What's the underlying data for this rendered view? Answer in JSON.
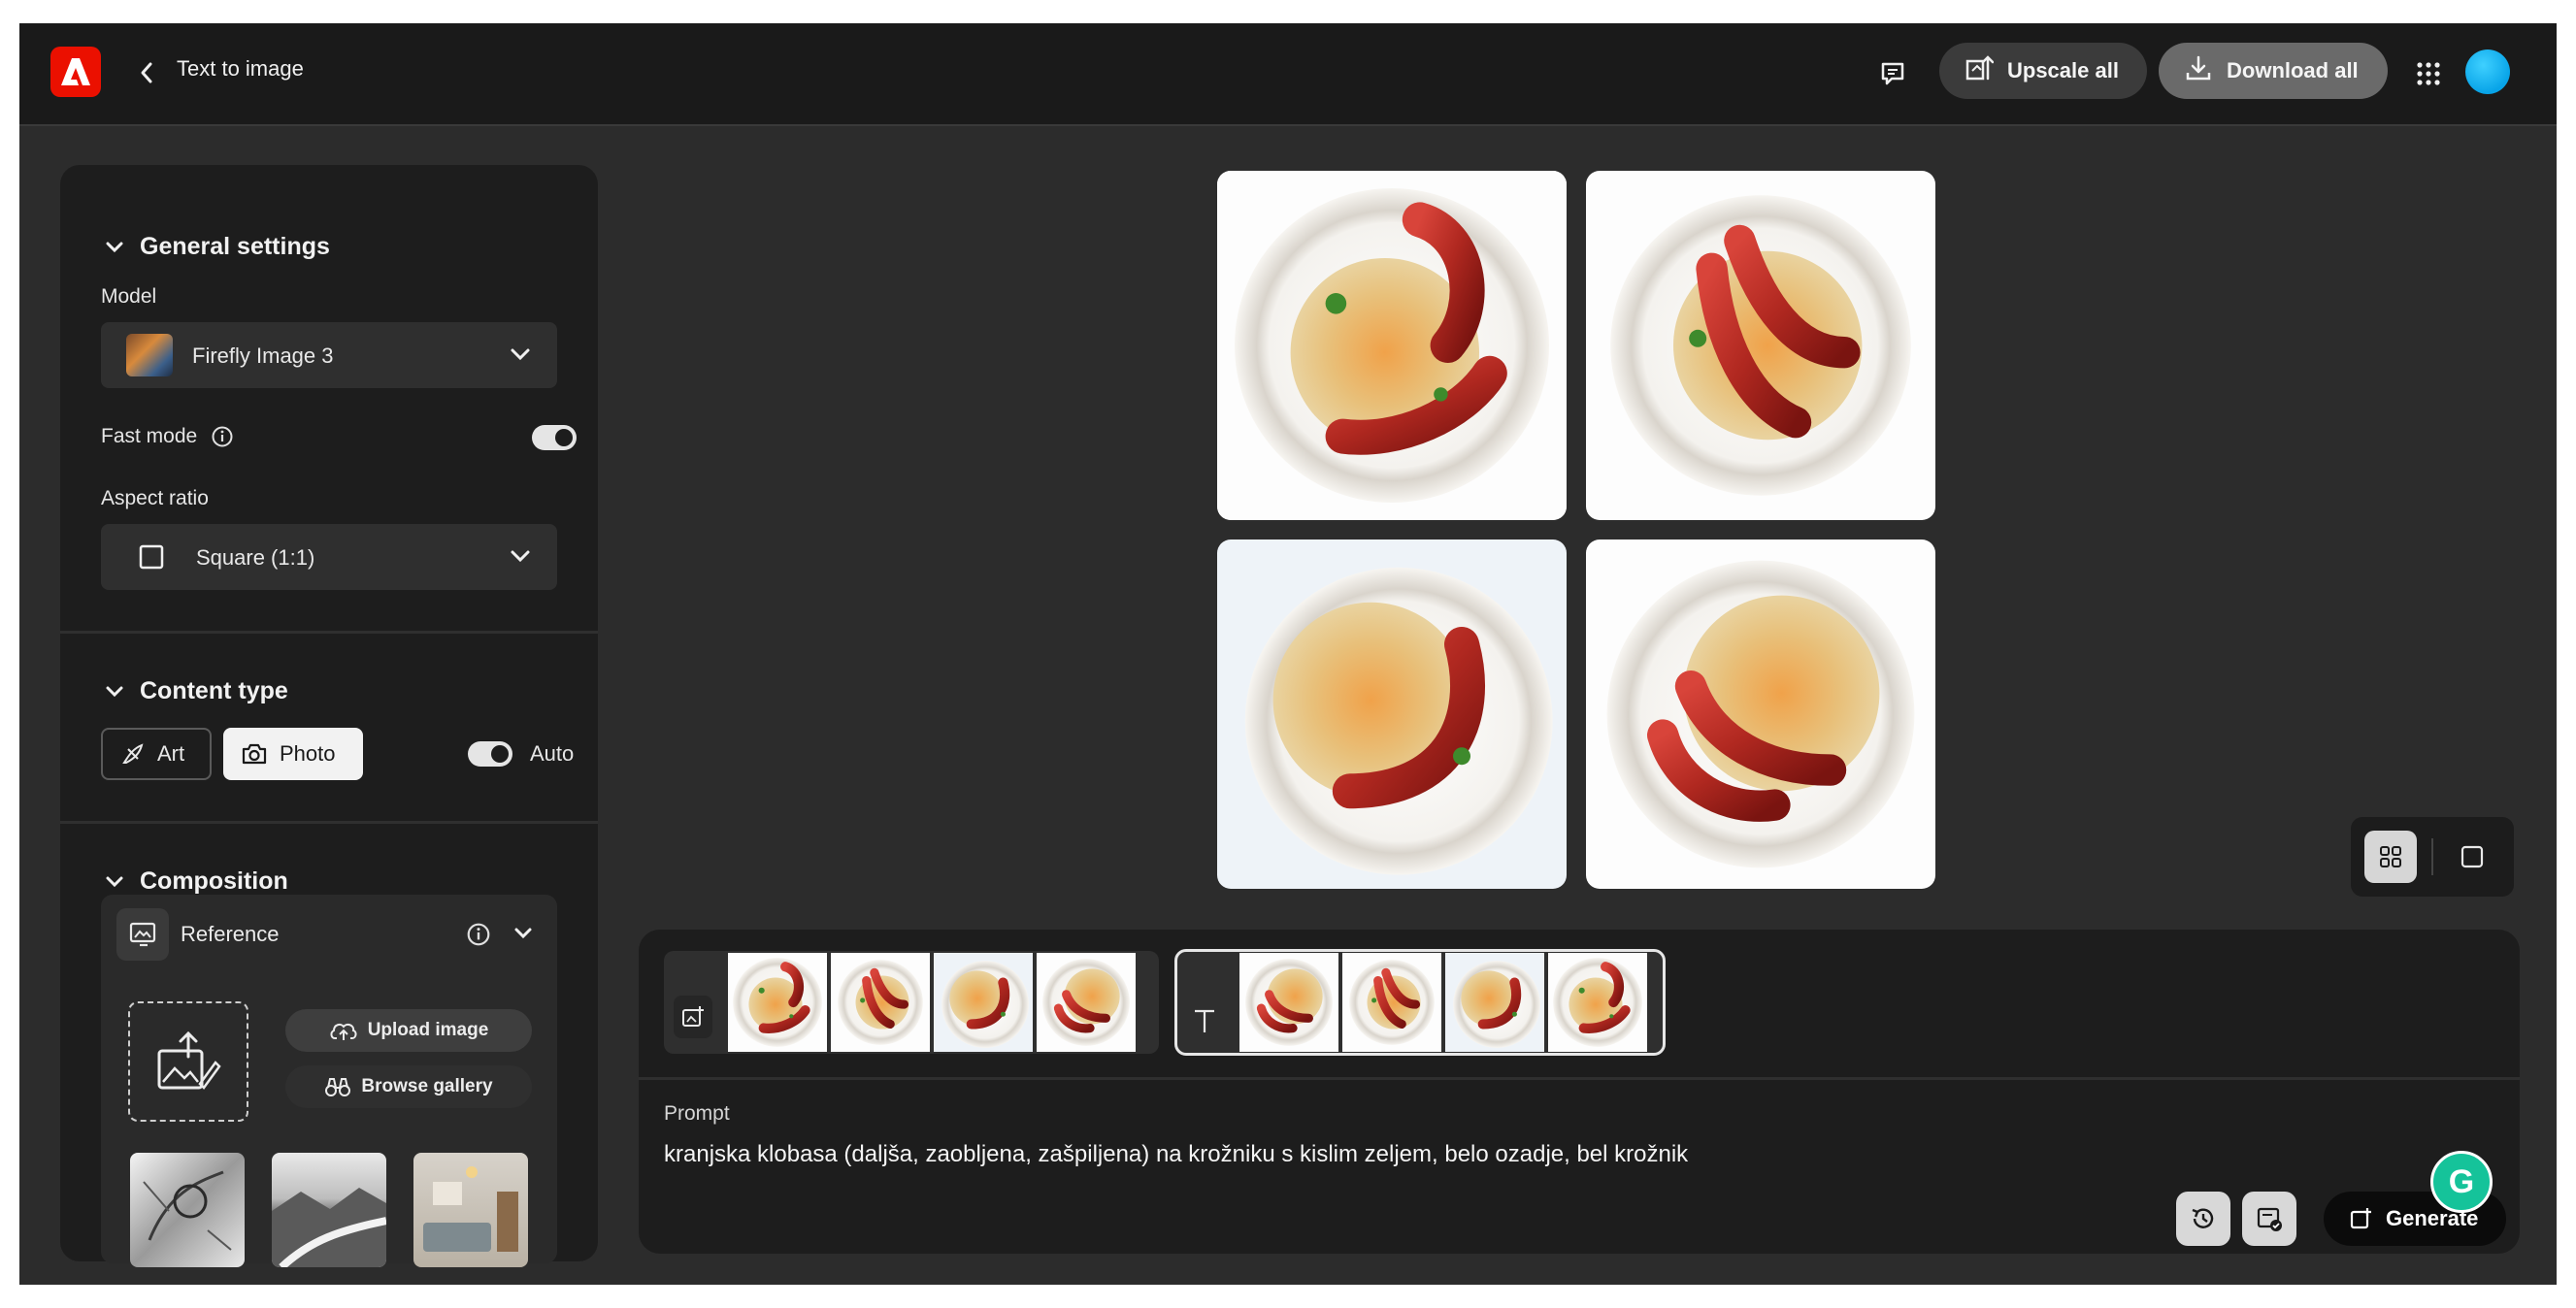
{
  "header": {
    "title": "Text to image",
    "upscale_label": "Upscale all",
    "download_label": "Download all"
  },
  "settings": {
    "general_title": "General settings",
    "model_label": "Model",
    "model_value": "Firefly Image 3",
    "fast_mode_label": "Fast mode",
    "fast_mode_on": true,
    "aspect_label": "Aspect ratio",
    "aspect_value": "Square (1:1)"
  },
  "content_type": {
    "title": "Content type",
    "art_label": "Art",
    "photo_label": "Photo",
    "auto_label": "Auto",
    "selected": "Photo"
  },
  "composition": {
    "title": "Composition",
    "reference_label": "Reference",
    "upload_label": "Upload image",
    "browse_label": "Browse gallery"
  },
  "prompt": {
    "label": "Prompt",
    "text": "kranjska klobasa (daljša, zaobljena, zašpiljena) na krožniku s kislim zeljem, belo ozadje, bel krožnik"
  },
  "generate_label": "Generate",
  "grammarly_letter": "G",
  "colors": {
    "adobe_red": "#eb1000",
    "panel_bg": "#1d1d1d",
    "app_bg": "#2c2c2c",
    "grammarly_green": "#15c39a",
    "avatar_blue": "#08a4e8"
  },
  "icons": [
    "adobe-logo-icon",
    "back-chevron-icon",
    "feedback-icon",
    "upscale-icon",
    "download-icon",
    "apps-grid-icon",
    "info-icon",
    "square-ratio-icon",
    "art-icon",
    "camera-icon",
    "reference-icon",
    "upload-cloud-icon",
    "binoculars-icon",
    "history-icon",
    "prompt-settings-icon",
    "generate-icon"
  ]
}
